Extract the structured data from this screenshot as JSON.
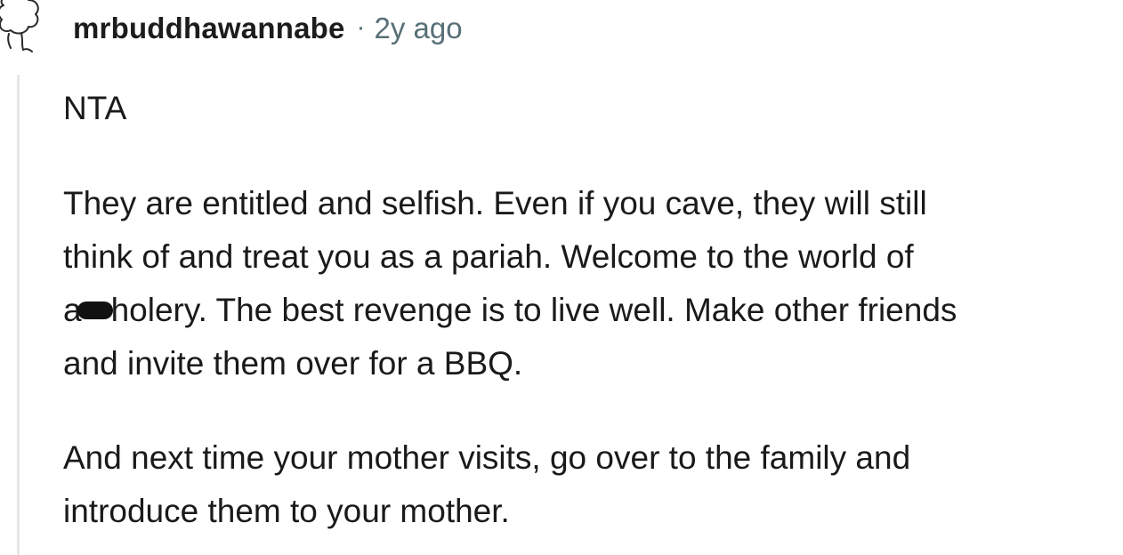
{
  "comment": {
    "username": "mrbuddhawannabe",
    "separator": "·",
    "timestamp": "2y ago",
    "paragraphs": [
      [
        "NTA"
      ],
      [
        "They are entitled and selfish. Even if you cave, they will still",
        "think of and treat you as a pariah. Welcome to the world of",
        "a",
        "holery. The best revenge is to live well. Make other friends",
        "and invite them over for a BBQ."
      ],
      [
        "And next time your mother visits, go over to the family and",
        "introduce them to your mother."
      ]
    ]
  },
  "icons": {
    "avatar": "snoo-avatar-icon",
    "censor": "censor-scribble"
  },
  "colors": {
    "text": "#1a1a1b",
    "meta": "#576f76",
    "thread_line": "#e5e8ea"
  }
}
